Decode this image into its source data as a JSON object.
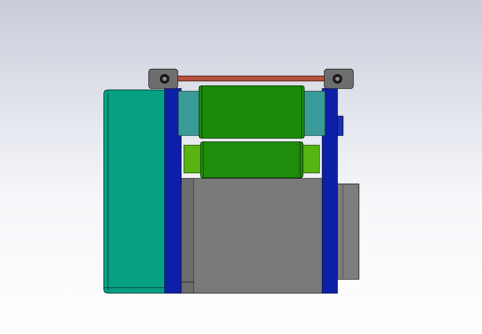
{
  "viewport": {
    "background_top": "#c9ccd8",
    "background_bottom": "#ffffff"
  },
  "model": {
    "parts": [
      {
        "name": "side-cover",
        "color": "#07a084"
      },
      {
        "name": "left-frame-plate",
        "color": "#0c1fa6"
      },
      {
        "name": "right-frame-plate",
        "color": "#0c1fa6"
      },
      {
        "name": "motor-housing",
        "color": "#7a7a7a"
      },
      {
        "name": "rear-motor-cap",
        "color": "#7d7d7d"
      },
      {
        "name": "upper-roller",
        "color": "#1a8a0a"
      },
      {
        "name": "lower-roller",
        "color": "#1f8c0c"
      },
      {
        "name": "roller-shaft-ends",
        "color": "#58b412"
      },
      {
        "name": "teal-bearing-blocks",
        "color": "#3a9a98"
      },
      {
        "name": "tension-rod",
        "color": "#b8523c"
      },
      {
        "name": "tensioner-brackets",
        "color": "#6e6e6e"
      }
    ]
  }
}
